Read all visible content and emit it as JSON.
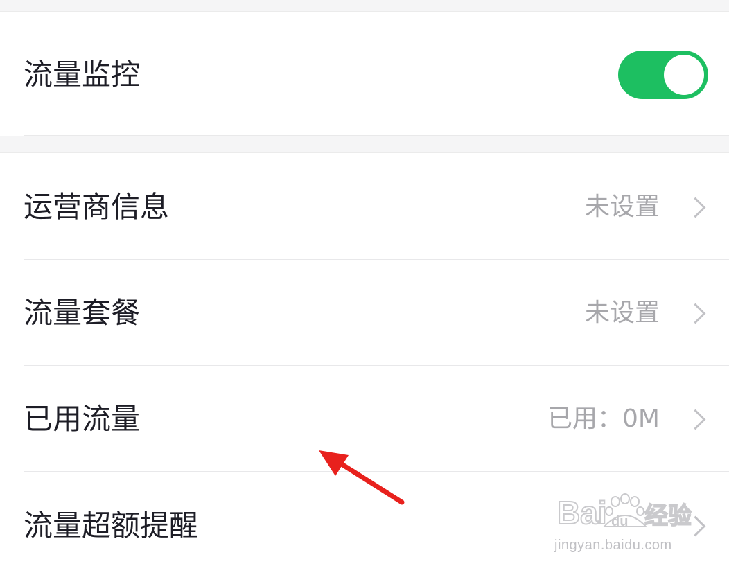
{
  "traffic_monitor": {
    "label": "流量监控",
    "enabled": true,
    "accent_color": "#1dbf61"
  },
  "settings": [
    {
      "label": "运营商信息",
      "value": "未设置"
    },
    {
      "label": "流量套餐",
      "value": "未设置"
    },
    {
      "label": "已用流量",
      "value": "已用：0M"
    },
    {
      "label": "流量超额提醒",
      "value": ""
    }
  ],
  "icons": {
    "chevron": "chevron-right-icon",
    "annotation": "red-arrow-annotation"
  },
  "annotation_color": "#e8211d",
  "watermark": {
    "logo": "Bai du 经验",
    "url": "jingyan.baidu.com"
  }
}
